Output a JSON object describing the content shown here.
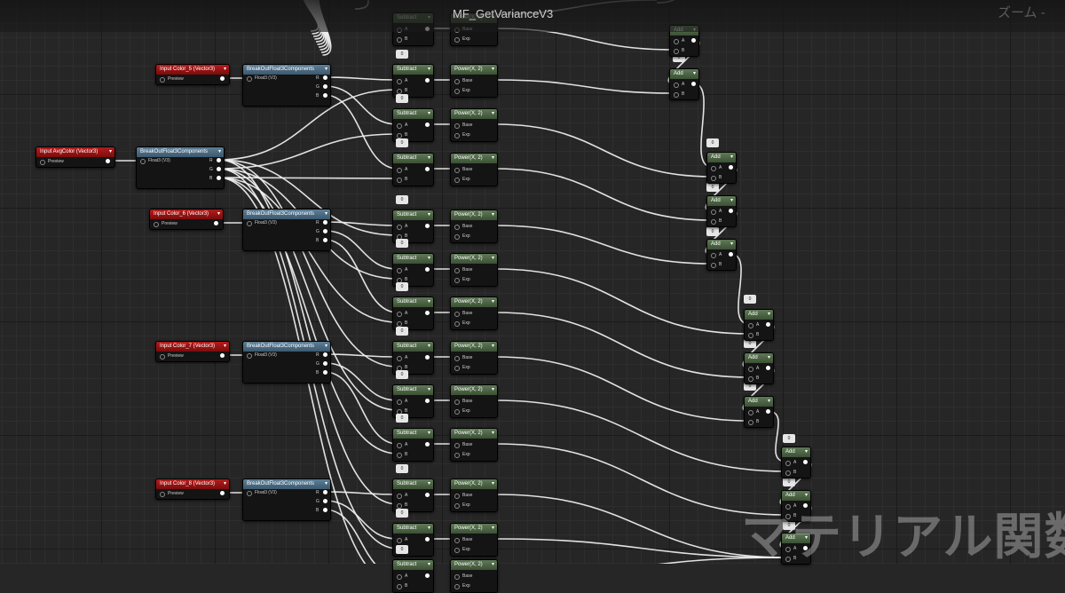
{
  "editor": {
    "title": "MF_GetVarianceV3",
    "zoom_label": "ズーム -",
    "watermark": "マテリアル関数"
  },
  "labels": {
    "preview": "Preview",
    "float3": "Float3 (V3)",
    "r": "R",
    "g": "G",
    "b": "B",
    "a": "A",
    "b_in": "B",
    "base": "Base",
    "exp": "Exp"
  },
  "nodes": {
    "avg_input": "Input AvgColor (Vector3)",
    "input5": "Input Color_5 (Vector3)",
    "input6": "Input Color_6 (Vector3)",
    "input7": "Input Color_7 (Vector3)",
    "input8": "Input Color_8 (Vector3)",
    "break": "BreakOutFloat3Components",
    "subtract": "Subtract",
    "power": "Power(X, 2)",
    "add": "Add",
    "const_zero": "0"
  },
  "colors": {
    "input_header": "#9e1515",
    "break_header": "#4f6d83",
    "math_header": "#4d6646",
    "wire": "#f2f2f2",
    "background": "#262626"
  }
}
